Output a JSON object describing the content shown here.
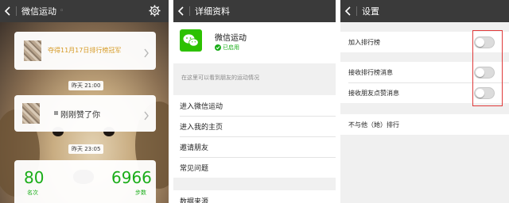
{
  "screen1": {
    "title": "微信运动",
    "nav_extra": "◦",
    "rank_card_text": "夺得11月17日排行榜冠军",
    "time1": "昨天 21:00",
    "like_card_text": "刚刚赞了你",
    "time2": "昨天 23:05",
    "rank": "80",
    "rank_label": "名次",
    "steps": "6966",
    "steps_label": "步数"
  },
  "screen2": {
    "title": "详细资料",
    "app_name": "微信运动",
    "status": "已启用",
    "hint": "在这里可以看到朋友的运动情况",
    "menu": [
      {
        "label": "进入微信运动"
      },
      {
        "label": "进入我的主页"
      },
      {
        "label": "邀请朋友"
      },
      {
        "label": "常见问题"
      }
    ],
    "data_source": "数据来源"
  },
  "screen3": {
    "title": "设置",
    "rows1": [
      {
        "label": "加入排行榜",
        "on": false
      }
    ],
    "rows2": [
      {
        "label": "接收排行榜消息",
        "on": false
      },
      {
        "label": "接收朋友点赞消息",
        "on": false
      }
    ],
    "row3": "不与他（她）排行"
  },
  "colors": {
    "navbar": "#3a3a3a",
    "wechat_green": "#1aad19",
    "gold": "#d69a25",
    "highlight_red": "#e03a3a"
  }
}
